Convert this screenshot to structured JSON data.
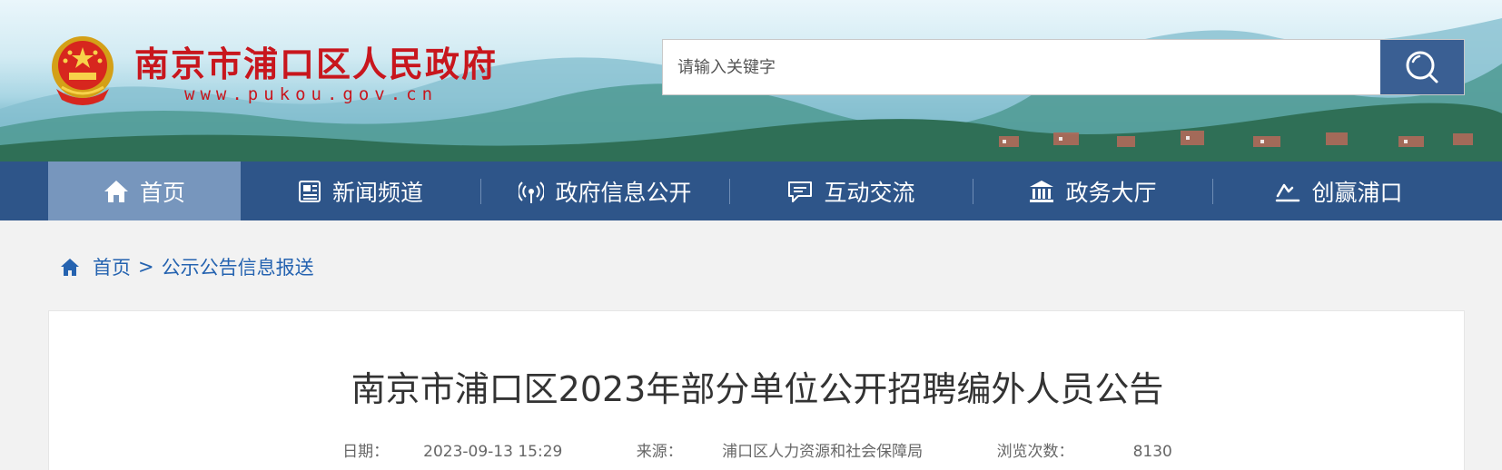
{
  "header": {
    "site_title": "南京市浦口区人民政府",
    "site_url": "www.pukou.gov.cn",
    "emblem": "national-emblem",
    "search": {
      "placeholder": "请输入关键字",
      "button_icon": "search-icon"
    }
  },
  "nav": {
    "items": [
      {
        "label": "首页",
        "icon": "home-icon",
        "active": true
      },
      {
        "label": "新闻频道",
        "icon": "newspaper-icon",
        "active": false
      },
      {
        "label": "政府信息公开",
        "icon": "broadcast-icon",
        "active": false
      },
      {
        "label": "互动交流",
        "icon": "chat-icon",
        "active": false
      },
      {
        "label": "政务大厅",
        "icon": "government-hall-icon",
        "active": false
      },
      {
        "label": "创赢浦口",
        "icon": "trend-icon",
        "active": false
      }
    ]
  },
  "breadcrumb": {
    "home": "首页",
    "separator": ">",
    "current": "公示公告信息报送"
  },
  "article": {
    "title": "南京市浦口区2023年部分单位公开招聘编外人员公告",
    "date_label": "日期：",
    "date_value": "2023-09-13 15:29",
    "source_label": "来源：",
    "source_value": "浦口区人力资源和社会保障局",
    "views_label": "浏览次数：",
    "views_value": "8130"
  },
  "colors": {
    "brand_red": "#c8161d",
    "nav_blue": "#2e5589",
    "nav_active": "#7796bd",
    "link_blue": "#2563b0"
  }
}
